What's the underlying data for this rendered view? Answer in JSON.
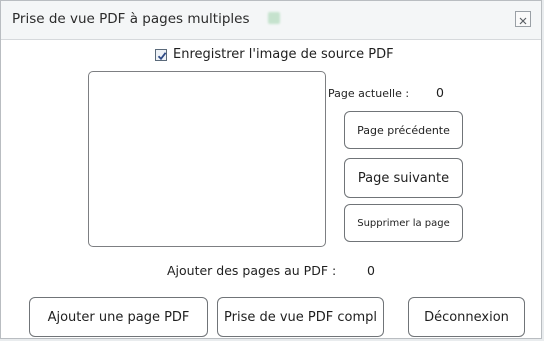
{
  "window": {
    "title": "Prise de vue PDF à pages multiples",
    "close_icon": "close-icon"
  },
  "options": {
    "save_source_label": "Enregistrer l'image de source PDF",
    "save_source_checked": true
  },
  "page_info": {
    "current_page_label": "Page actuelle :",
    "current_page_value": "0"
  },
  "nav_buttons": {
    "previous_label": "Page précédente",
    "next_label": "Page suivante",
    "delete_label": "Supprimer la page"
  },
  "added_pages": {
    "label": "Ajouter des pages au PDF :",
    "value": "0"
  },
  "footer_buttons": {
    "add_page_label": "Ajouter une page PDF",
    "full_capture_label": "Prise de vue PDF compl",
    "disconnect_label": "Déconnexion"
  },
  "colors": {
    "window_bg": "#ffffff",
    "titlebar_bg": "#f4f6f7",
    "border": "#707478",
    "checkbox_check": "#2e4a86"
  }
}
